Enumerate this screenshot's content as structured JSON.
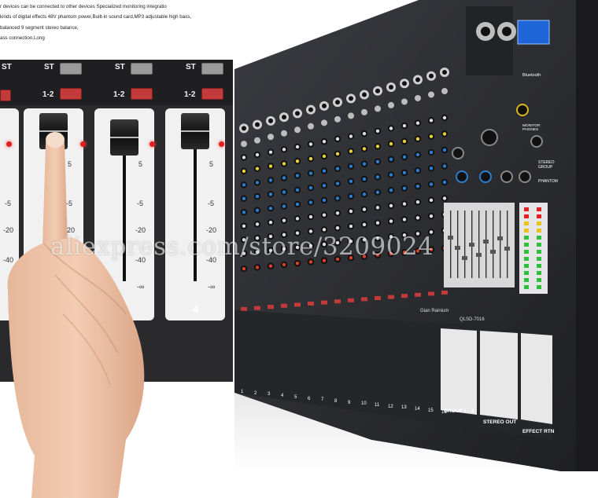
{
  "description_lines": [
    "r devices can be connected to other devices Specialized monitoring integratio",
    "kinds of digital effects 48V phantom power,Built-in sound card,MP3 adjustable high bass,",
    "balanced 9 segment stereo balance,",
    "ass connection,Long"
  ],
  "zoom_inset": {
    "st_label": "ST",
    "group_label": "1-2",
    "ticks_left": [
      "5",
      "-5",
      "-20",
      "-40"
    ],
    "ticks_middle": [
      "5",
      "-5",
      "-20",
      "-40",
      "-∞"
    ],
    "ticks_right": [
      "5",
      "-5",
      "-20",
      "-40",
      "-∞"
    ],
    "channel_number": "4"
  },
  "mixer": {
    "model": "QLSD-7016",
    "brand": "Gian Rainium",
    "bluetooth_label": "Bluetooth",
    "phantom_label": "PHANTOM",
    "stereo_group_label": "STEREO GROUP",
    "monitor_phones_label": "MONITOR PHONES",
    "channel_labels": [
      "1",
      "2",
      "3",
      "4",
      "5",
      "6",
      "7",
      "8",
      "9",
      "10",
      "11",
      "12",
      "13",
      "14",
      "15",
      "16"
    ],
    "section_labels": {
      "group": "GROUP 1 - 2",
      "stereo_out": "STEREO OUT",
      "effect_rtn": "EFFECT RTN"
    }
  },
  "watermark": "aliexpress.com/store/3209024",
  "colors": {
    "mixer_body": "#2b2c30",
    "knob_yellow": "#e8d23a",
    "knob_blue": "#2b7fd0",
    "knob_red": "#d8412b",
    "fader_red": "#e2321e",
    "fader_yellow": "#f2c21a",
    "fader_blue": "#4a9ae0",
    "display_blue": "#1e66d8"
  }
}
